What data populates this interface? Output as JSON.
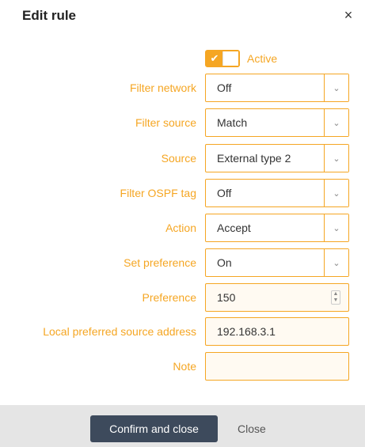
{
  "dialog": {
    "title": "Edit rule",
    "close_glyph": "×"
  },
  "active_toggle": {
    "label": "Active",
    "checked": true,
    "check_glyph": "✔"
  },
  "fields": {
    "filter_network": {
      "label": "Filter network",
      "value": "Off"
    },
    "filter_source": {
      "label": "Filter source",
      "value": "Match"
    },
    "source": {
      "label": "Source",
      "value": "External type 2"
    },
    "filter_ospf_tag": {
      "label": "Filter OSPF tag",
      "value": "Off"
    },
    "action": {
      "label": "Action",
      "value": "Accept"
    },
    "set_preference": {
      "label": "Set preference",
      "value": "On"
    },
    "preference": {
      "label": "Preference",
      "value": "150"
    },
    "local_preferred_source_address": {
      "label": "Local preferred source address",
      "value": "192.168.3.1"
    },
    "note": {
      "label": "Note",
      "value": ""
    }
  },
  "icons": {
    "dropdown": "⌄",
    "spin_up": "▲",
    "spin_down": "▼"
  },
  "footer": {
    "confirm_label": "Confirm and close",
    "close_label": "Close"
  },
  "colors": {
    "accent": "#f5a623",
    "primary_button": "#3d4a5c",
    "footer_bg": "#e5e5e5"
  }
}
